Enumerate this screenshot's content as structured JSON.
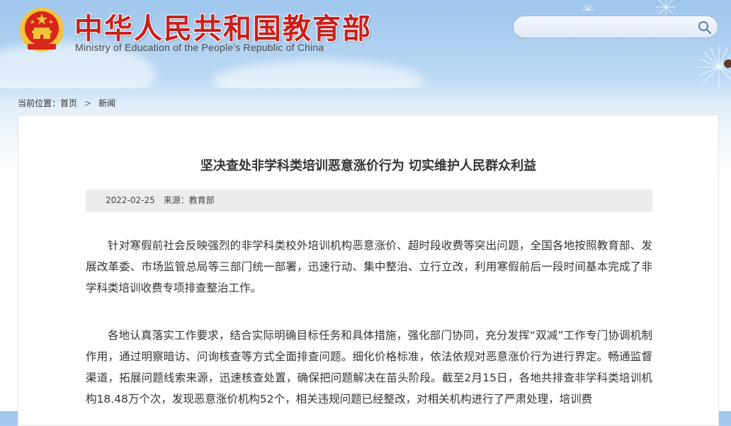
{
  "header": {
    "title": "中华人民共和国教育部",
    "subtitle": "Ministry of Education of the People's Republic of China",
    "search": {
      "placeholder": ""
    }
  },
  "breadcrumb": {
    "prefix": "当前位置：",
    "items": [
      "首页",
      "新闻"
    ],
    "separator": ">"
  },
  "article": {
    "title": "坚决查处非学科类培训恶意涨价行为 切实维护人民群众利益",
    "date": "2022-02-25",
    "source": "来源：教育部",
    "paragraphs": [
      "针对寒假前社会反映强烈的非学科类校外培训机构恶意涨价、超时段收费等突出问题，全国各地按照教育部、发展改革委、市场监管总局等三部门统一部署，迅速行动、集中整治、立行立改，利用寒假前后一段时间基本完成了非学科类培训收费专项排查整治工作。",
      "各地认真落实工作要求，结合实际明确目标任务和具体措施，强化部门协同，充分发挥“双减”工作专门协调机制作用，通过明察暗访、问询核查等方式全面排查问题。细化价格标准，依法依规对恶意涨价行为进行界定。畅通监督渠道，拓展问题线索来源，迅速核查处置，确保把问题解决在苗头阶段。截至2月15日，各地共排查非学科类培训机构18.48万个次，发现恶意涨价机构52个，相关违规问题已经整改，对相关机构进行了严肃处理，培训费"
    ]
  },
  "colors": {
    "title_red": "#c8201c",
    "emblem_red": "#d7261b",
    "emblem_gold": "#f3c33a"
  }
}
